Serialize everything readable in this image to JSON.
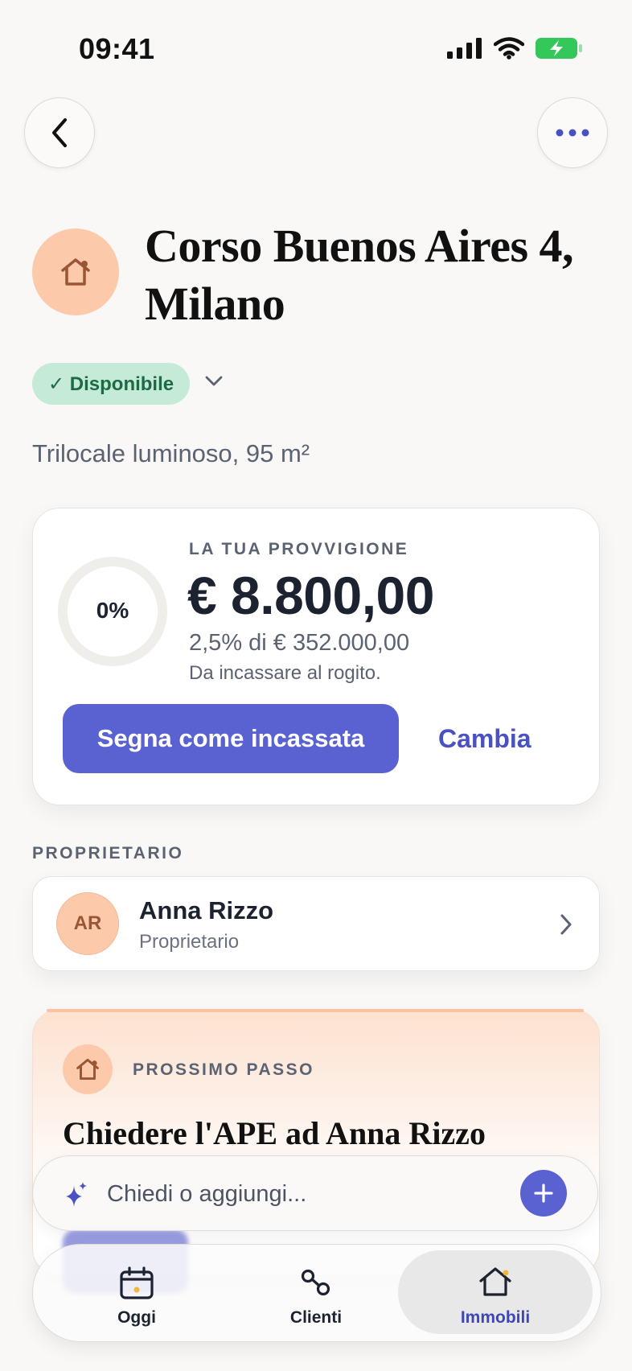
{
  "status_bar": {
    "time": "09:41"
  },
  "header": {
    "title": "Corso Buenos Aires 4, Milano",
    "status": "✓ Disponibile",
    "subtitle": "Trilocale luminoso, 95 m²"
  },
  "commission": {
    "progress_label": "0%",
    "progress": 0,
    "eyebrow": "LA TUA PROVVIGIONE",
    "amount": "€ 8.800,00",
    "detail": "2,5% di € 352.000,00",
    "note": "Da incassare al rogito.",
    "primary_action": "Segna come incassata",
    "secondary_action": "Cambia"
  },
  "owner": {
    "section_label": "PROPRIETARIO",
    "initials": "AR",
    "name": "Anna Rizzo",
    "role": "Proprietario"
  },
  "next_step": {
    "eyebrow": "PROSSIMO PASSO",
    "title": "Chiedere l'APE ad Anna Rizzo"
  },
  "composer": {
    "placeholder": "Chiedi o aggiungi..."
  },
  "tabs": [
    {
      "label": "Oggi",
      "icon": "calendar-icon"
    },
    {
      "label": "Clienti",
      "icon": "connections-icon"
    },
    {
      "label": "Immobili",
      "icon": "home-icon"
    }
  ],
  "colors": {
    "accent": "#5a61d1",
    "available_bg": "#c5ead7",
    "available_text": "#1e6a45",
    "peach": "#fcc9ab"
  }
}
